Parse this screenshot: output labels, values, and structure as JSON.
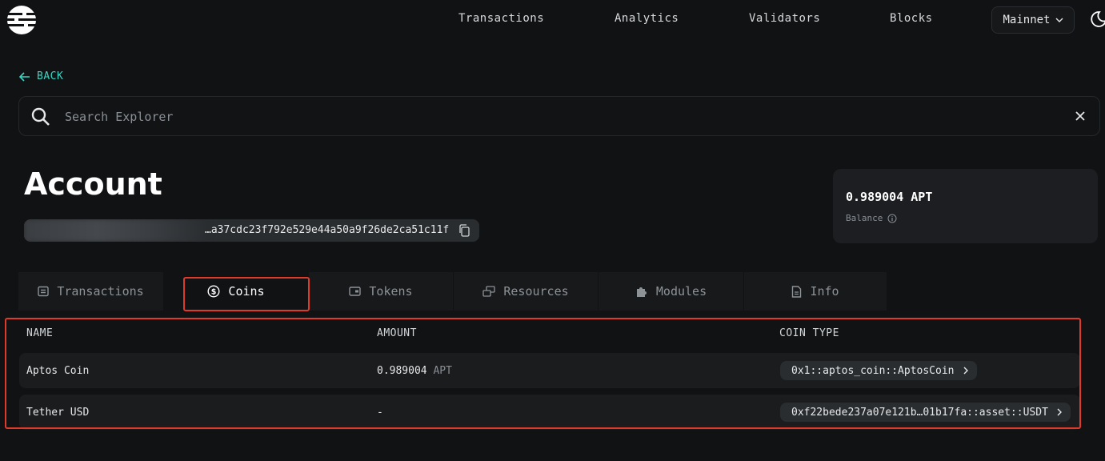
{
  "header": {
    "logo_icon": "aptos-logo-icon",
    "nav": [
      "Transactions",
      "Analytics",
      "Validators",
      "Blocks"
    ],
    "network": "Mainnet",
    "theme_icon": "moon-icon"
  },
  "back": {
    "label": "BACK"
  },
  "search": {
    "placeholder": "Search Explorer"
  },
  "account": {
    "title": "Account",
    "address_visible": "…a37cdc23f792e529e44a50a9f26de2ca51c11f"
  },
  "balance": {
    "value": "0.989004 APT",
    "label": "Balance"
  },
  "tabs": [
    {
      "label": "Transactions",
      "icon": "receipt-icon"
    },
    {
      "label": "Coins",
      "icon": "coin-icon"
    },
    {
      "label": "Tokens",
      "icon": "wallet-icon"
    },
    {
      "label": "Resources",
      "icon": "stack-icon"
    },
    {
      "label": "Modules",
      "icon": "puzzle-icon"
    },
    {
      "label": "Info",
      "icon": "document-icon"
    }
  ],
  "table": {
    "headers": [
      "NAME",
      "AMOUNT",
      "COIN TYPE"
    ],
    "rows": [
      {
        "name": "Aptos Coin",
        "amount": "0.989004",
        "unit": "APT",
        "coin_type": "0x1::aptos_coin::AptosCoin"
      },
      {
        "name": "Tether USD",
        "amount": "-",
        "unit": "",
        "coin_type": "0xf22bede237a07e121b…01b17fa::asset::USDT"
      }
    ]
  },
  "colors": {
    "accent": "#38d6c4",
    "highlight": "#e03a2b",
    "background": "#111214"
  }
}
